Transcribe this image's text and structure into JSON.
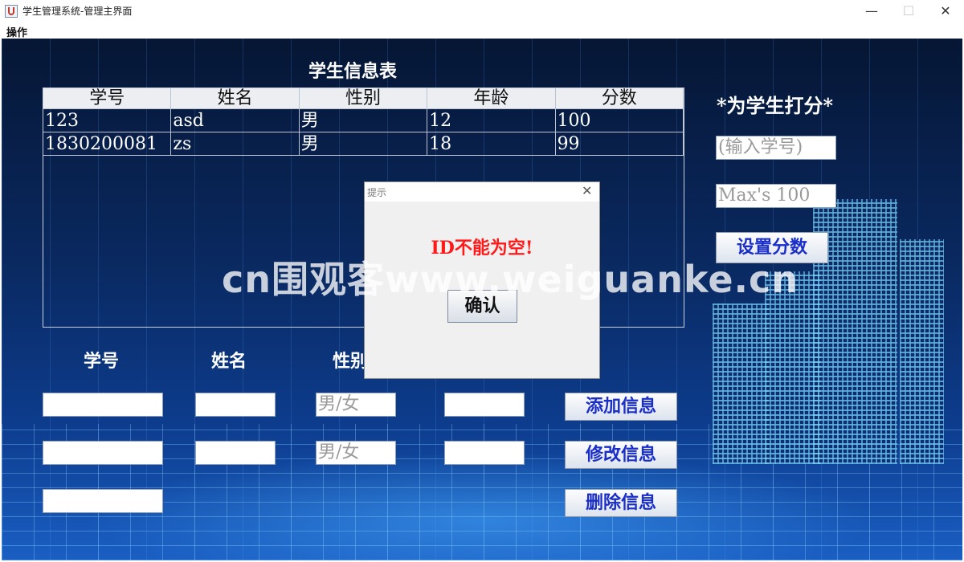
{
  "window": {
    "title": "学生管理系统-管理主界面",
    "min": "—",
    "max": "☐",
    "close": "✕"
  },
  "menu": {
    "operate": "操作"
  },
  "table": {
    "title": "学生信息表",
    "headers": [
      "学号",
      "姓名",
      "性别",
      "年龄",
      "分数"
    ],
    "rows": [
      [
        "123",
        "asd",
        "男",
        "12",
        "100"
      ],
      [
        "1830200081",
        "zs",
        "男",
        "18",
        "99"
      ]
    ]
  },
  "form": {
    "labels": {
      "id": "学号",
      "name": "姓名",
      "gender": "性别"
    },
    "add_row": {
      "id": "",
      "name": "",
      "gender_placeholder": "男/女",
      "age": ""
    },
    "edit_row": {
      "id": "",
      "name": "",
      "gender_placeholder": "男/女",
      "age": ""
    },
    "delete_row": {
      "id": ""
    },
    "buttons": {
      "add": "添加信息",
      "edit": "修改信息",
      "delete": "删除信息"
    }
  },
  "score_panel": {
    "title": "*为学生打分*",
    "id_placeholder": "(输入学号)",
    "score_placeholder": "Max's 100",
    "button": "设置分数"
  },
  "dialog": {
    "title": "提示",
    "close": "✕",
    "message": "ID不能为空!",
    "ok": "确认"
  },
  "watermark": "cn围观客www.weiguanke.cn",
  "colors": {
    "button_text": "#1a2ec8",
    "dialog_message": "#ff1a1a"
  }
}
